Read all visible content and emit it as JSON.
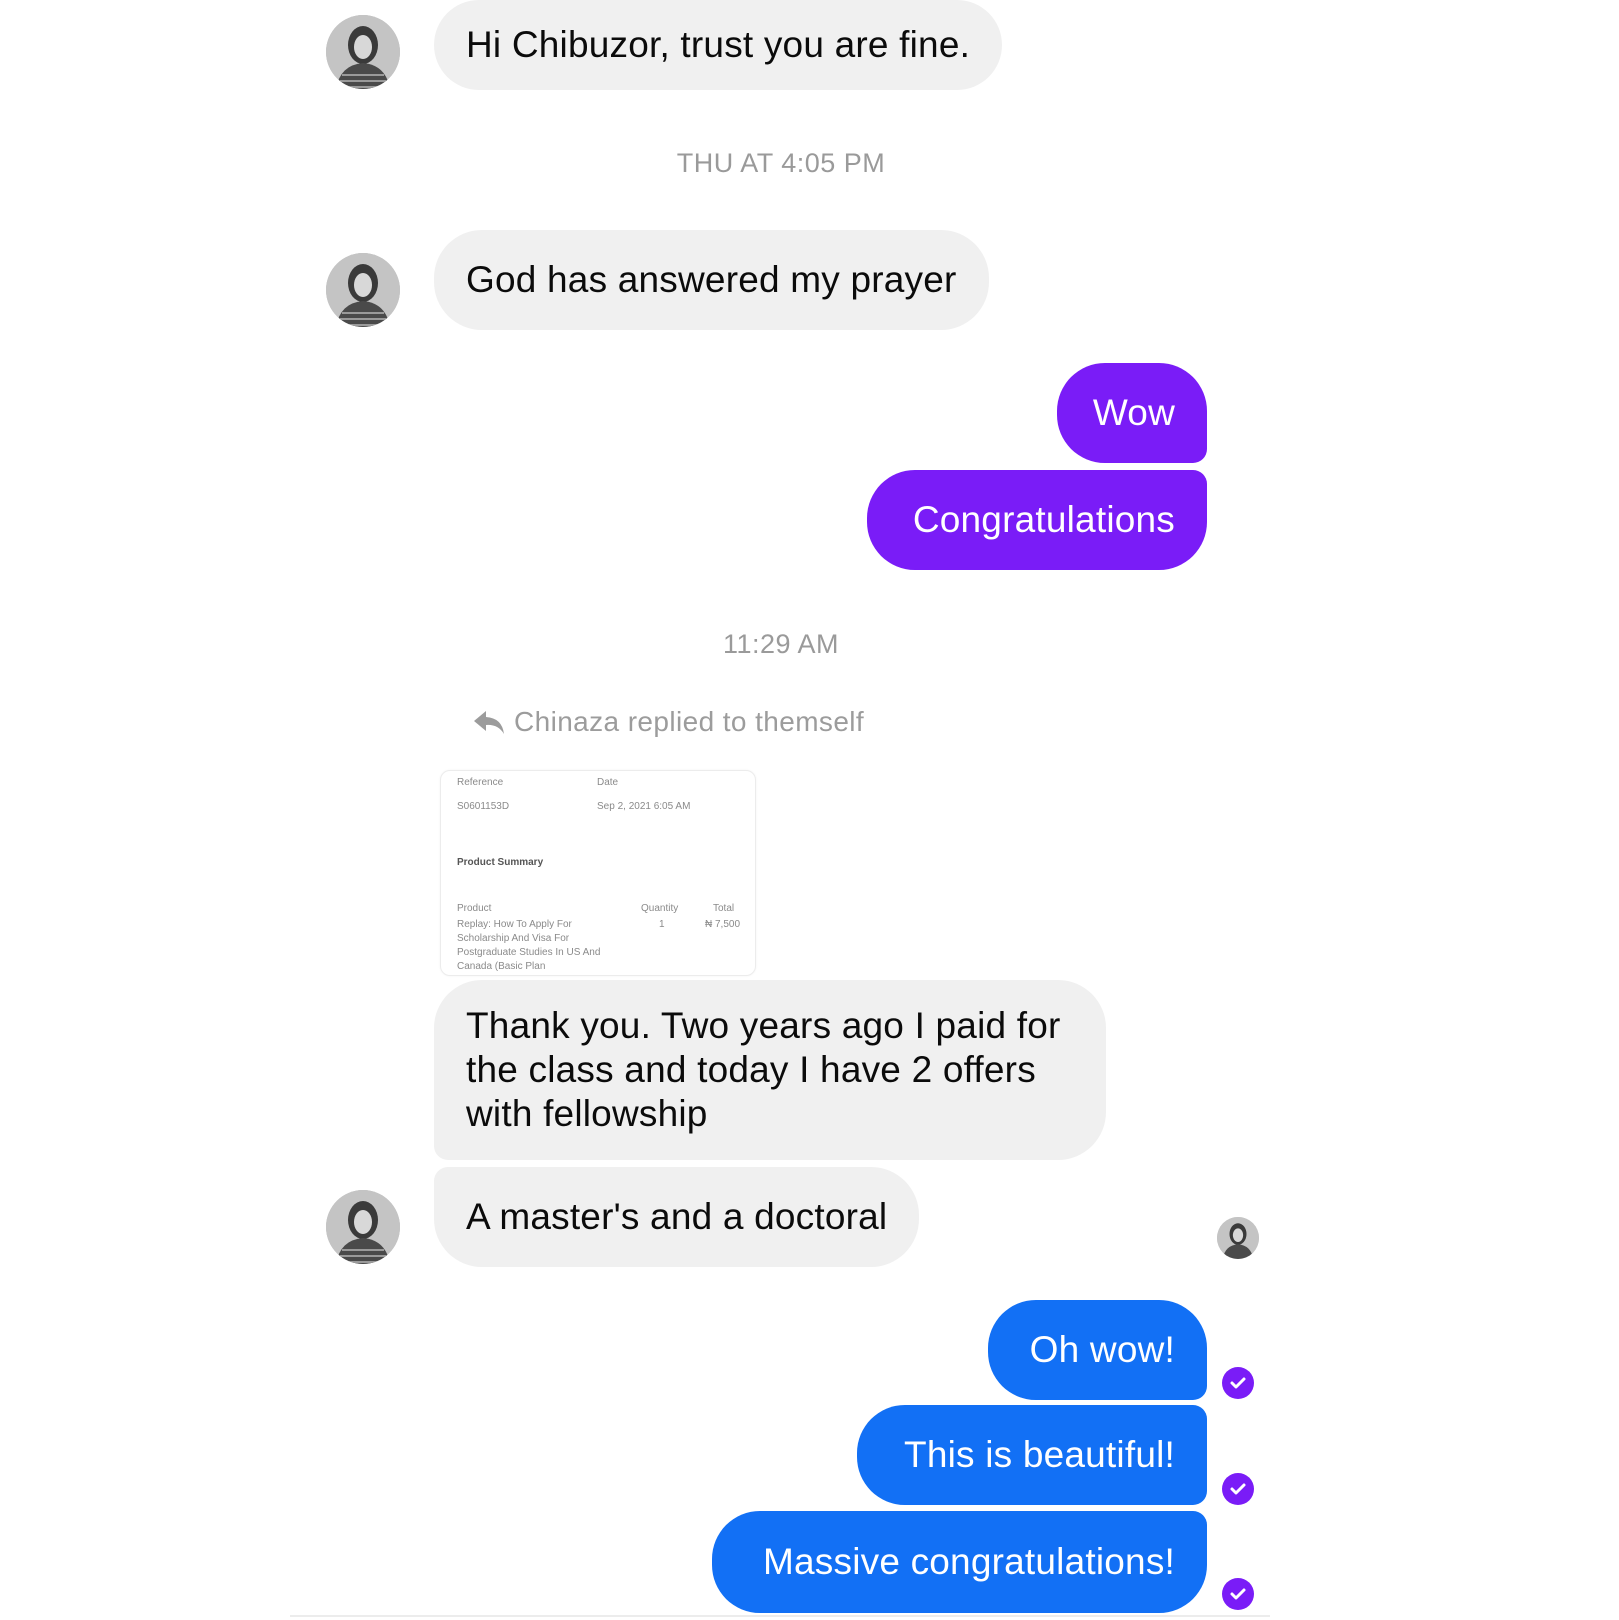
{
  "contact": {
    "name": "Chinaza",
    "avatar_icon": "user-avatar-icon"
  },
  "colors": {
    "incoming_bg": "#f0f0f0",
    "outgoing_purple": "#7a1cf7",
    "outgoing_blue": "#1270f5",
    "timestamp": "#9a9a9a"
  },
  "messages": {
    "m1": "Hi Chibuzor, trust you are fine.",
    "ts1": "THU AT 4:05 PM",
    "m2": "God has answered my prayer",
    "m3": "Wow",
    "m4": "Congratulations",
    "ts2": "11:29 AM",
    "reply_note": "Chinaza replied to themself",
    "m5": "Thank you. Two years ago I paid for the class and today I have 2 offers with fellowship",
    "m6": "A master's and a doctoral",
    "m7": "Oh wow!",
    "m8": "This is beautiful!",
    "m9": "Massive congratulations!"
  },
  "receipt": {
    "reference_label": "Reference",
    "reference_value": "S0601153D",
    "date_label": "Date",
    "date_value": "Sep 2, 2021 6:05 AM",
    "summary_title": "Product Summary",
    "col_product": "Product",
    "col_quantity": "Quantity",
    "col_total": "Total",
    "product_lines": [
      "Replay: How To Apply For",
      "Scholarship And Visa For",
      "Postgraduate Studies In US And",
      "Canada (Basic Plan"
    ],
    "quantity": "1",
    "total": "₦ 7,500"
  }
}
